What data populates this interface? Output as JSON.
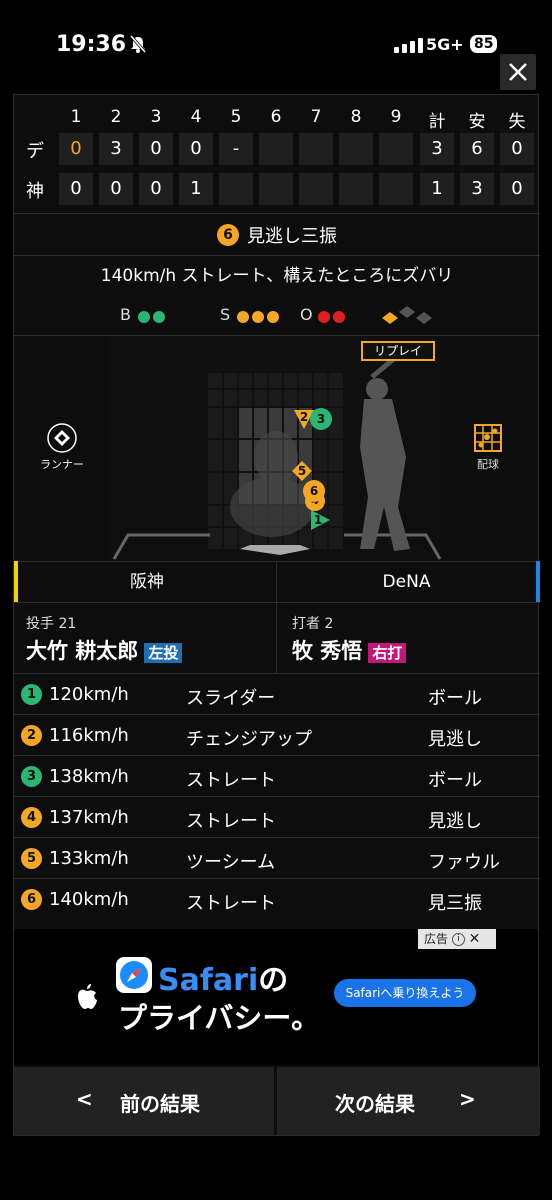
{
  "status": {
    "time": "19:36",
    "network": "5G+",
    "battery": "85"
  },
  "scoreboard": {
    "innings": [
      "1",
      "2",
      "3",
      "4",
      "5",
      "6",
      "7",
      "8",
      "9"
    ],
    "totals_labels": [
      "計",
      "安",
      "失"
    ],
    "teams": [
      {
        "name": "デ",
        "innings": [
          "0",
          "3",
          "0",
          "0",
          "-",
          "",
          "",
          "",
          ""
        ],
        "totals": [
          "3",
          "6",
          "0"
        ]
      },
      {
        "name": "神",
        "innings": [
          "0",
          "0",
          "0",
          "1",
          "",
          "",
          "",
          "",
          ""
        ],
        "totals": [
          "1",
          "3",
          "0"
        ]
      }
    ]
  },
  "result": {
    "number": "6",
    "text": "見逃し三振"
  },
  "description": "140km/h ストレート、構えたところにズバリ",
  "count": {
    "b_label": "B",
    "s_label": "S",
    "o_label": "O"
  },
  "field": {
    "replay_label": "リプレイ",
    "runner_label": "ランナー",
    "pitch_chart_label": "配球",
    "markers": [
      "1",
      "2",
      "3",
      "4",
      "5",
      "6"
    ]
  },
  "teams": {
    "home": "阪神",
    "away": "DeNA"
  },
  "pitcher": {
    "role": "投手 21",
    "name": "大竹 耕太郎",
    "hand": "左投"
  },
  "batter": {
    "role": "打者 2",
    "name": "牧 秀悟",
    "hand": "右打"
  },
  "pitches": [
    {
      "num": "1",
      "speed": "120km/h",
      "type": "スライダー",
      "result": "ボール",
      "color": "#2bb673"
    },
    {
      "num": "2",
      "speed": "116km/h",
      "type": "チェンジアップ",
      "result": "見逃し",
      "color": "#f5a623"
    },
    {
      "num": "3",
      "speed": "138km/h",
      "type": "ストレート",
      "result": "ボール",
      "color": "#2bb673"
    },
    {
      "num": "4",
      "speed": "137km/h",
      "type": "ストレート",
      "result": "見逃し",
      "color": "#f5a623"
    },
    {
      "num": "5",
      "speed": "133km/h",
      "type": "ツーシーム",
      "result": "ファウル",
      "color": "#f5a623"
    },
    {
      "num": "6",
      "speed": "140km/h",
      "type": "ストレート",
      "result": "見三振",
      "color": "#f5a623"
    }
  ],
  "ad": {
    "label": "広告",
    "brand": "Safari",
    "title_suffix": "の",
    "title_line2": "プライバシー。",
    "cta": "Safariへ乗り換えよう"
  },
  "nav": {
    "prev": "前の結果",
    "next": "次の結果",
    "prev_arrow": "<",
    "next_arrow": ">"
  },
  "colors": {
    "ball": "#2bb673",
    "strike": "#f5a623",
    "out": "#e02020",
    "away_score": "#f5a623",
    "pitcher_hand": "#1f6fb2",
    "batter_hand": "#c2187a"
  }
}
